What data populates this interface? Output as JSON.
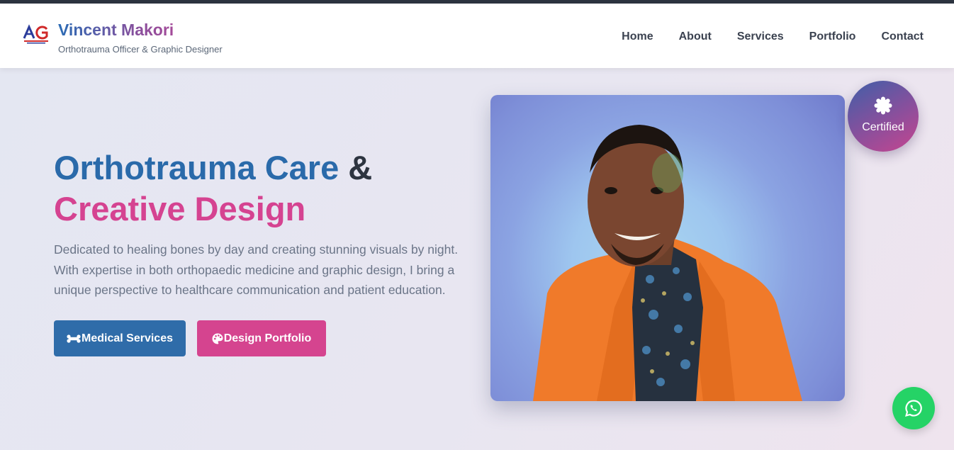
{
  "header": {
    "brand_name": "Vincent Makori",
    "tagline": "Orthotrauma Officer & Graphic Designer",
    "logo_icon": "ag-logo-icon"
  },
  "nav": {
    "items": [
      {
        "label": "Home"
      },
      {
        "label": "About"
      },
      {
        "label": "Services"
      },
      {
        "label": "Portfolio"
      },
      {
        "label": "Contact"
      }
    ]
  },
  "hero": {
    "title_part1": "Orthotrauma Care",
    "title_amp": "&",
    "title_part2": "Creative Design",
    "description": "Dedicated to healing bones by day and creating stunning visuals by night. With expertise in both orthopaedic medicine and graphic design, I bring a unique perspective to healthcare communication and patient education.",
    "buttons": {
      "medical": {
        "label": "Medical Services",
        "icon": "bone-icon"
      },
      "design": {
        "label": "Design Portfolio",
        "icon": "palette-icon"
      }
    }
  },
  "badge": {
    "label": "Certified",
    "icon": "certificate-icon"
  },
  "floating": {
    "whatsapp_icon": "whatsapp-icon"
  },
  "colors": {
    "primary_blue": "#2a6aaa",
    "accent_pink": "#d54391",
    "dark_text": "#2d3440",
    "whatsapp_green": "#25d366"
  }
}
